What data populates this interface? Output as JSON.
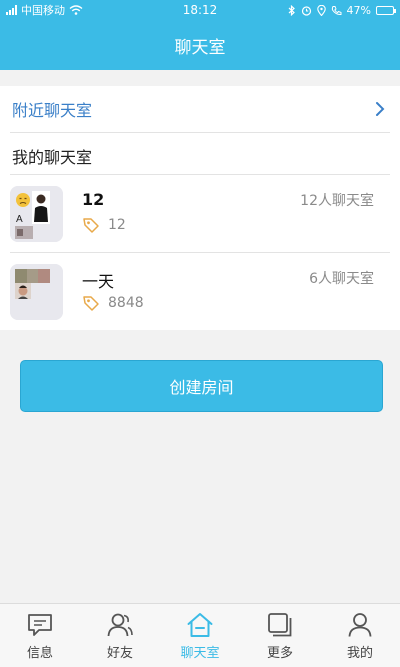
{
  "status_bar": {
    "carrier": "中国移动",
    "time": "18:12",
    "battery": "47%",
    "battery_level": 0.47
  },
  "header": {
    "title": "聊天室"
  },
  "nearby": {
    "label": "附近聊天室"
  },
  "my_rooms": {
    "title": "我的聊天室",
    "rooms": [
      {
        "name": "12",
        "member_count": "12人聊天室",
        "tag_id": "12"
      },
      {
        "name": "一天",
        "member_count": "6人聊天室",
        "tag_id": "8848"
      }
    ]
  },
  "create_button": {
    "label": "创建房间"
  },
  "tabs": [
    {
      "label": "信息",
      "icon": "message-icon"
    },
    {
      "label": "好友",
      "icon": "friends-icon"
    },
    {
      "label": "聊天室",
      "icon": "home-icon",
      "active": true
    },
    {
      "label": "更多",
      "icon": "more-icon"
    },
    {
      "label": "我的",
      "icon": "profile-icon"
    }
  ],
  "colors": {
    "primary": "#3bbbe6",
    "link": "#3a7fc8",
    "tag": "#e8a94a",
    "muted": "#8a8a8a"
  }
}
